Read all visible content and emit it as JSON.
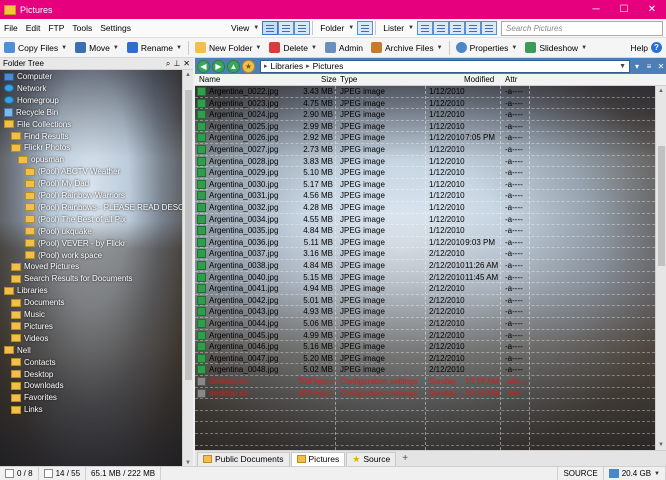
{
  "window": {
    "title": "Pictures",
    "min": "─",
    "max": "☐",
    "close": "✕"
  },
  "menu": [
    "File",
    "Edit",
    "FTP",
    "Tools",
    "Settings"
  ],
  "toolbar1": {
    "view": "View",
    "folder": "Folder",
    "lister": "Lister",
    "search_placeholder": "Search Pictures"
  },
  "toolbar2": {
    "copy": "Copy Files",
    "move": "Move",
    "rename": "Rename",
    "new_folder": "New Folder",
    "delete": "Delete",
    "admin": "Admin",
    "archive": "Archive Files",
    "properties": "Properties",
    "slideshow": "Slideshow",
    "help": "Help"
  },
  "tree": {
    "header": "Folder Tree",
    "items": [
      {
        "label": "Computer",
        "icon": "computer-icon",
        "level": 1
      },
      {
        "label": "Network",
        "icon": "network-icon",
        "level": 1
      },
      {
        "label": "Homegroup",
        "icon": "homegroup-icon",
        "level": 1
      },
      {
        "label": "Recycle Bin",
        "icon": "recycle-bin-icon",
        "level": 1
      },
      {
        "label": "File Collections",
        "icon": "folder-icon",
        "level": 1
      },
      {
        "label": "Find Results",
        "icon": "folder-icon",
        "level": 2
      },
      {
        "label": "Flickr Photos",
        "icon": "folder-icon",
        "level": 2
      },
      {
        "label": "opusman",
        "icon": "folder-icon",
        "level": 3
      },
      {
        "label": "(Pool) ABCTV Weather",
        "icon": "folder-icon",
        "level": 4
      },
      {
        "label": "(Pool) My Dad",
        "icon": "folder-icon",
        "level": 4
      },
      {
        "label": "(Pool) Rainbow Warriors",
        "icon": "folder-icon",
        "level": 4
      },
      {
        "label": "(Pool) Rainbows - PLEASE READ DESCRIPTI",
        "icon": "folder-icon",
        "level": 4
      },
      {
        "label": "(Pool) The Best of all Pix",
        "icon": "folder-icon",
        "level": 4
      },
      {
        "label": "(Pool) ukquake",
        "icon": "folder-icon",
        "level": 4
      },
      {
        "label": "(Pool) VEVER - by Flickr",
        "icon": "folder-icon",
        "level": 4
      },
      {
        "label": "(Pool) work space",
        "icon": "folder-icon",
        "level": 4
      },
      {
        "label": "Moved Pictures",
        "icon": "folder-icon",
        "level": 2
      },
      {
        "label": "Search Results for Documents",
        "icon": "folder-icon",
        "level": 2
      },
      {
        "label": "Libraries",
        "icon": "folder-icon",
        "level": 1
      },
      {
        "label": "Documents",
        "icon": "folder-icon",
        "level": 2
      },
      {
        "label": "Music",
        "icon": "folder-icon",
        "level": 2
      },
      {
        "label": "Pictures",
        "icon": "folder-icon",
        "level": 2
      },
      {
        "label": "Videos",
        "icon": "folder-icon",
        "level": 2
      },
      {
        "label": "Nell",
        "icon": "folder-icon",
        "level": 1
      },
      {
        "label": "Contacts",
        "icon": "folder-icon",
        "level": 2
      },
      {
        "label": "Desktop",
        "icon": "folder-icon",
        "level": 2
      },
      {
        "label": "Downloads",
        "icon": "folder-icon",
        "level": 2
      },
      {
        "label": "Favorites",
        "icon": "folder-icon",
        "level": 2
      },
      {
        "label": "Links",
        "icon": "folder-icon",
        "level": 2
      }
    ]
  },
  "address": {
    "crumbs": [
      "Libraries",
      "Pictures"
    ]
  },
  "columns": {
    "name": "Name",
    "size": "Size",
    "type": "Type",
    "modified": "Modified",
    "attr": "Attr"
  },
  "files": [
    {
      "name": "Argentina_0022.jpg",
      "size": "3.43 MB",
      "type": "JPEG image",
      "modified": "1/12/2010",
      "time": "",
      "attr": "-a----"
    },
    {
      "name": "Argentina_0023.jpg",
      "size": "4.75 MB",
      "type": "JPEG image",
      "modified": "1/12/2010",
      "time": "",
      "attr": "-a----"
    },
    {
      "name": "Argentina_0024.jpg",
      "size": "2.90 MB",
      "type": "JPEG image",
      "modified": "1/12/2010",
      "time": "",
      "attr": "-a----"
    },
    {
      "name": "Argentina_0025.jpg",
      "size": "2.99 MB",
      "type": "JPEG image",
      "modified": "1/12/2010",
      "time": "",
      "attr": "-a----"
    },
    {
      "name": "Argentina_0026.jpg",
      "size": "2.92 MB",
      "type": "JPEG image",
      "modified": "1/12/2010",
      "time": "7:05 PM",
      "attr": "-a----"
    },
    {
      "name": "Argentina_0027.jpg",
      "size": "2.73 MB",
      "type": "JPEG image",
      "modified": "1/12/2010",
      "time": "",
      "attr": "-a----"
    },
    {
      "name": "Argentina_0028.jpg",
      "size": "3.83 MB",
      "type": "JPEG image",
      "modified": "1/12/2010",
      "time": "",
      "attr": "-a----"
    },
    {
      "name": "Argentina_0029.jpg",
      "size": "5.10 MB",
      "type": "JPEG image",
      "modified": "1/12/2010",
      "time": "",
      "attr": "-a----"
    },
    {
      "name": "Argentina_0030.jpg",
      "size": "5.17 MB",
      "type": "JPEG image",
      "modified": "1/12/2010",
      "time": "",
      "attr": "-a----"
    },
    {
      "name": "Argentina_0031.jpg",
      "size": "4.56 MB",
      "type": "JPEG image",
      "modified": "1/12/2010",
      "time": "",
      "attr": "-a----"
    },
    {
      "name": "Argentina_0032.jpg",
      "size": "4.28 MB",
      "type": "JPEG image",
      "modified": "1/12/2010",
      "time": "",
      "attr": "-a----"
    },
    {
      "name": "Argentina_0034.jpg",
      "size": "4.55 MB",
      "type": "JPEG image",
      "modified": "1/12/2010",
      "time": "",
      "attr": "-a----"
    },
    {
      "name": "Argentina_0035.jpg",
      "size": "4.84 MB",
      "type": "JPEG image",
      "modified": "1/12/2010",
      "time": "",
      "attr": "-a----"
    },
    {
      "name": "Argentina_0036.jpg",
      "size": "5.11 MB",
      "type": "JPEG image",
      "modified": "1/12/2010",
      "time": "9:03 PM",
      "attr": "-a----"
    },
    {
      "name": "Argentina_0037.jpg",
      "size": "3.16 MB",
      "type": "JPEG image",
      "modified": "2/12/2010",
      "time": "",
      "attr": "-a----"
    },
    {
      "name": "Argentina_0038.jpg",
      "size": "4.84 MB",
      "type": "JPEG image",
      "modified": "2/12/2010",
      "time": "11:26 AM",
      "attr": "-a----"
    },
    {
      "name": "Argentina_0040.jpg",
      "size": "5.15 MB",
      "type": "JPEG image",
      "modified": "2/12/2010",
      "time": "11:45 AM",
      "attr": "-a----"
    },
    {
      "name": "Argentina_0041.jpg",
      "size": "4.94 MB",
      "type": "JPEG image",
      "modified": "2/12/2010",
      "time": "",
      "attr": "-a----"
    },
    {
      "name": "Argentina_0042.jpg",
      "size": "5.01 MB",
      "type": "JPEG image",
      "modified": "2/12/2010",
      "time": "",
      "attr": "-a----"
    },
    {
      "name": "Argentina_0043.jpg",
      "size": "4.93 MB",
      "type": "JPEG image",
      "modified": "2/12/2010",
      "time": "",
      "attr": "-a----"
    },
    {
      "name": "Argentina_0044.jpg",
      "size": "5.06 MB",
      "type": "JPEG image",
      "modified": "2/12/2010",
      "time": "",
      "attr": "-a----"
    },
    {
      "name": "Argentina_0045.jpg",
      "size": "4.99 MB",
      "type": "JPEG image",
      "modified": "2/12/2010",
      "time": "",
      "attr": "-a----"
    },
    {
      "name": "Argentina_0046.jpg",
      "size": "5.16 MB",
      "type": "JPEG image",
      "modified": "2/12/2010",
      "time": "",
      "attr": "-a----"
    },
    {
      "name": "Argentina_0047.jpg",
      "size": "5.20 MB",
      "type": "JPEG image",
      "modified": "2/12/2010",
      "time": "",
      "attr": "-a----"
    },
    {
      "name": "Argentina_0048.jpg",
      "size": "5.02 MB",
      "type": "JPEG image",
      "modified": "2/12/2010",
      "time": "",
      "attr": "-a----"
    },
    {
      "name": "desktop.ini",
      "size": "504 bytes",
      "type": "Configuration settings",
      "modified": "Sunday",
      "time": "10:19 AM",
      "attr": "-ahs-",
      "red": true
    },
    {
      "name": "desktop.ini",
      "size": "502 bytes",
      "type": "Configuration settings",
      "modified": "Sunday",
      "time": "10:19 AM",
      "attr": "-ahs-",
      "red": true
    },
    {
      "name": "",
      "size": "",
      "type": "",
      "modified": "",
      "time": "",
      "attr": ""
    },
    {
      "name": "",
      "size": "",
      "type": "",
      "modified": "",
      "time": "",
      "attr": ""
    },
    {
      "name": "",
      "size": "",
      "type": "",
      "modified": "",
      "time": "",
      "attr": ""
    },
    {
      "name": "",
      "size": "",
      "type": "",
      "modified": "",
      "time": "",
      "attr": ""
    }
  ],
  "tabs": [
    {
      "label": "Public Documents",
      "active": false
    },
    {
      "label": "Pictures",
      "active": true
    },
    {
      "label": "Source",
      "active": false,
      "star": true
    }
  ],
  "status": {
    "selected": "0 / 8",
    "count": "14 / 55",
    "size": "65.1 MB / 222 MB",
    "source": "SOURCE",
    "free": "20.4 GB"
  }
}
